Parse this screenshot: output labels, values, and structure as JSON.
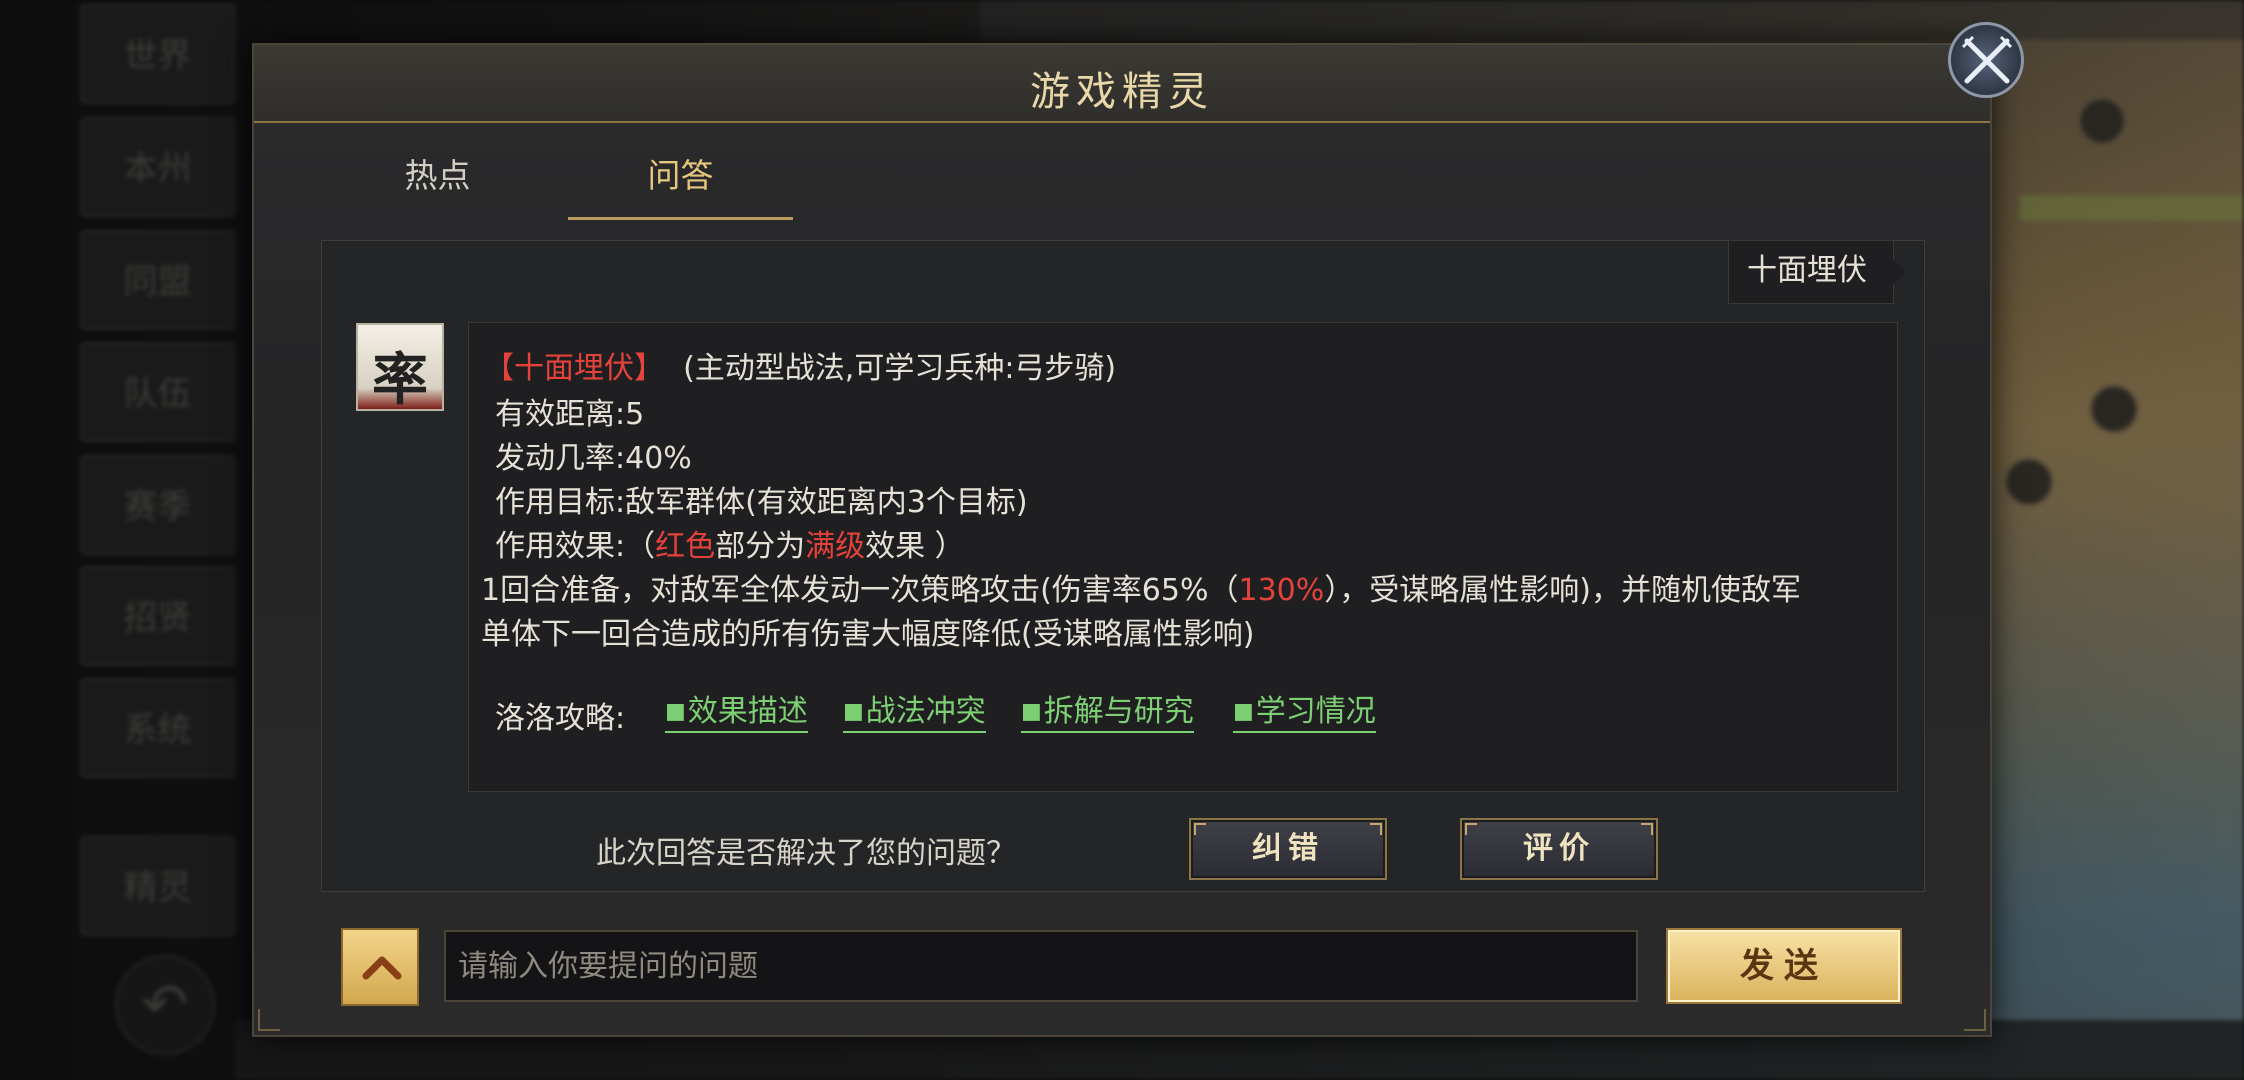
{
  "background": {
    "sidebar_buttons": [
      "世界",
      "本州",
      "同盟",
      "队伍",
      "赛季",
      "招贤",
      "系统",
      "精灵"
    ],
    "back_icon": "back-arrow-icon"
  },
  "dialog": {
    "title": "游戏精灵",
    "close_icon": "crossed-swords-close-icon",
    "tabs": [
      {
        "label": "热点",
        "active": false
      },
      {
        "label": "问答",
        "active": true
      }
    ],
    "question": "十面埋伏",
    "answer": {
      "avatar_glyph": "率",
      "skill_name": "【十面埋伏】",
      "skill_type": "(主动型战法,可学习兵种:弓步骑)",
      "range": "有效距离:5",
      "chance": "发动几率:40%",
      "target": "作用目标:敌军群体(有效距离内3个目标)",
      "effect_prefix": "作用效果:（",
      "effect_red1": "红色",
      "effect_mid": "部分为",
      "effect_red2": "满级",
      "effect_suffix": "效果 ）",
      "desc1_prefix": "1回合准备，对敌军全体发动一次策略攻击(伤害率65%（",
      "desc1_red": "130%",
      "desc1_suffix": "），受谋略属性影响)，并随机使敌军",
      "desc2": "单体下一回合造成的所有伤害大幅度降低(受谋略属性影响)",
      "strategy_label": "洛洛攻略:",
      "strategy_links": [
        "效果描述",
        "战法冲突",
        "拆解与研究",
        "学习情况"
      ]
    },
    "feedback": {
      "question": "此次回答是否解决了您的问题？",
      "correct_label": "纠错",
      "rate_label": "评价"
    },
    "input": {
      "placeholder": "请输入你要提问的问题",
      "value": ""
    },
    "send_label": "发送"
  },
  "colors": {
    "accent_gold": "#e6c77e",
    "highlight_red": "#e5423b",
    "link_green": "#7dcf73"
  }
}
